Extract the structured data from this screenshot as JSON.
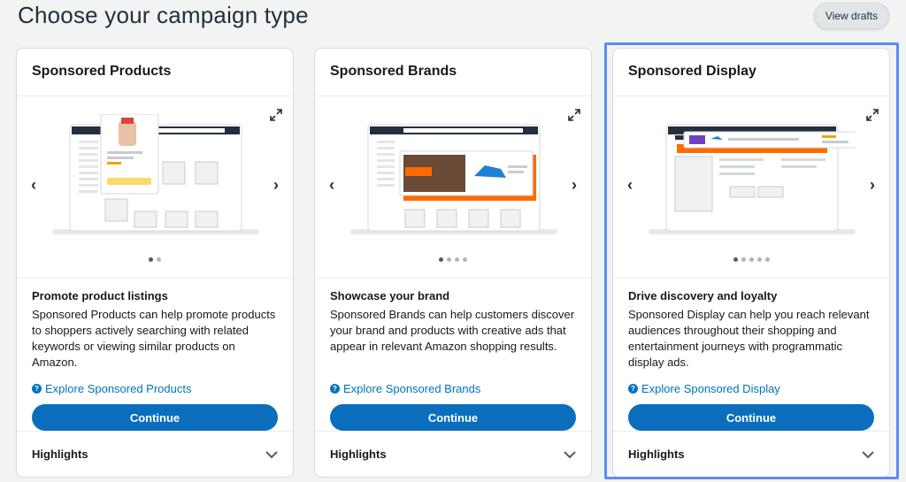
{
  "page": {
    "title": "Choose your campaign type",
    "view_drafts": "View drafts"
  },
  "cards": [
    {
      "header": "Sponsored Products",
      "subtitle": "Promote product listings",
      "description": "Sponsored Products can help promote products to shoppers actively searching with related keywords or viewing similar products on Amazon.",
      "explore": "Explore Sponsored Products",
      "continue": "Continue",
      "highlights": "Highlights",
      "carousel_slides": 2,
      "carousel_active": 1
    },
    {
      "header": "Sponsored Brands",
      "subtitle": "Showcase your brand",
      "description": "Sponsored Brands can help customers discover your brand and products with creative ads that appear in relevant Amazon shopping results.",
      "explore": "Explore Sponsored Brands",
      "continue": "Continue",
      "highlights": "Highlights",
      "carousel_slides": 4,
      "carousel_active": 1
    },
    {
      "header": "Sponsored Display",
      "subtitle": "Drive discovery and loyalty",
      "description": "Sponsored Display can help you reach relevant audiences throughout their shopping and entertainment journeys with programmatic display ads.",
      "explore": "Explore Sponsored Display",
      "continue": "Continue",
      "highlights": "Highlights",
      "carousel_slides": 5,
      "carousel_active": 1,
      "selected": true
    }
  ],
  "icons": {
    "expand": "expand-icon",
    "help": "help-circle-icon",
    "chevron": "chevron-down-icon",
    "prev": "chevron-left-icon",
    "next": "chevron-right-icon"
  },
  "colors": {
    "primary": "#0a6ebd",
    "link": "#0073bb",
    "selected_outline": "#5b8def",
    "accent_orange": "#ff6a00"
  }
}
